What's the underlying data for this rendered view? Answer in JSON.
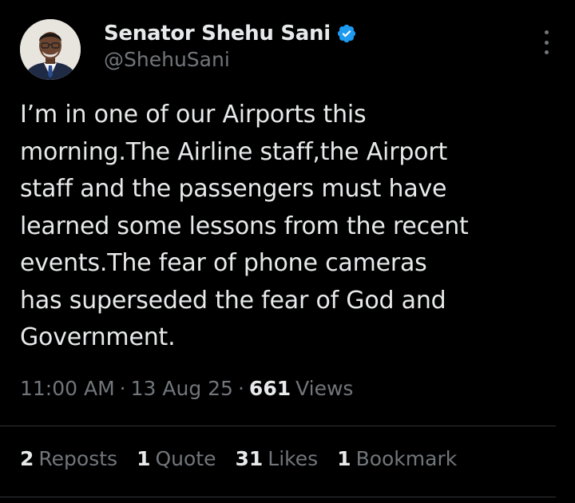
{
  "author": {
    "name": "Senator Shehu Sani",
    "handle": "@ShehuSani",
    "verified_color": "#1d9bf0"
  },
  "tweet": {
    "lines": [
      "I’m in one of our Airports this",
      "morning.The Airline staff,the Airport",
      "staff and the passengers must have",
      "learned some lessons from the recent",
      "events.The fear of phone cameras",
      "has superseded the fear of God and",
      "Government."
    ]
  },
  "meta": {
    "time": "11:00 AM",
    "separator": "·",
    "date": "13 Aug 25",
    "views_count": "661",
    "views_label": "Views"
  },
  "stats": [
    {
      "count": "2",
      "label": "Reposts"
    },
    {
      "count": "1",
      "label": "Quote"
    },
    {
      "count": "31",
      "label": "Likes"
    },
    {
      "count": "1",
      "label": "Bookmark"
    }
  ],
  "icons": {
    "verified": "verified-badge-icon",
    "more": "more-options-icon"
  },
  "colors": {
    "background": "#000000",
    "text_primary": "#e7e9ea",
    "text_secondary": "#71767b",
    "divider": "#2f3336"
  }
}
